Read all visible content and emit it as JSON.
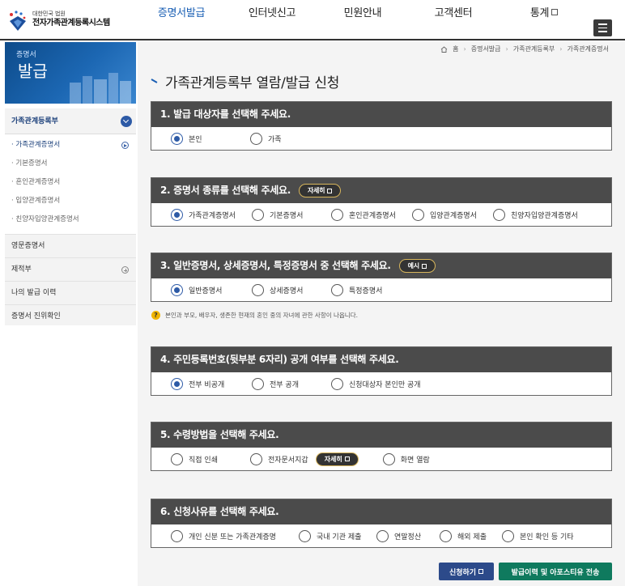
{
  "header": {
    "logo_sub": "대한민국 법원",
    "logo_main": "전자가족관계등록시스템",
    "nav": [
      {
        "label": "증명서발급",
        "active": true
      },
      {
        "label": "인터넷신고",
        "active": false
      },
      {
        "label": "민원안내",
        "active": false
      },
      {
        "label": "고객센터",
        "active": false
      },
      {
        "label": "통계",
        "active": false,
        "external": true
      }
    ]
  },
  "banner": {
    "small": "증명서",
    "big": "발급"
  },
  "sidebar": {
    "head": "가족관계등록부",
    "sub_items": [
      "· 가족관계증명서",
      "· 기본증명서",
      "· 혼인관계증명서",
      "· 입양관계증명서",
      "· 친양자입양관계증명서"
    ],
    "items": [
      "영문증명서",
      "제적부",
      "나의 발급 이력",
      "증명서 진위확인"
    ]
  },
  "breadcrumb": [
    "홈",
    "증명서발급",
    "가족관계등록부",
    "가족관계증명서"
  ],
  "page_title": "가족관계등록부 열람/발급 신청",
  "sections": [
    {
      "title": "1. 발급 대상자를 선택해 주세요.",
      "options": [
        "본인",
        "가족"
      ]
    },
    {
      "title": "2. 증명서 종류를 선택해 주세요.",
      "pill": "자세히",
      "options": [
        "가족관계증명서",
        "기본증명서",
        "혼인관계증명서",
        "입양관계증명서",
        "친양자입양관계증명서"
      ]
    },
    {
      "title": "3. 일반증명서, 상세증명서, 특정증명서 중 선택해 주세요.",
      "pill": "예시",
      "options": [
        "일반증명서",
        "상세증명서",
        "특정증명서"
      ]
    },
    {
      "title": "4. 주민등록번호(뒷부분 6자리) 공개 여부를 선택해 주세요.",
      "options": [
        "전부 비공개",
        "전부 공개",
        "신청대상자 본인만 공개"
      ]
    },
    {
      "title": "5. 수령방법을 선택해 주세요.",
      "options": [
        "직접 인쇄",
        "전자문서지갑",
        "화면 열람"
      ],
      "pill": "자세히"
    },
    {
      "title": "6. 신청사유를 선택해 주세요.",
      "options": [
        "개인 신분 또는 가족관계증명",
        "국내 기관 제출",
        "연말정산",
        "해외 제출",
        "본인 확인 등 기타"
      ]
    }
  ],
  "note": "본인과 부모, 배우자, 생존한 현재의 혼인 중의 자녀에 관한 사항이 나옵니다.",
  "note_icon": "?",
  "buttons": {
    "apply": "신청하기",
    "history": "발급이력 및 아포스티유 전송"
  }
}
